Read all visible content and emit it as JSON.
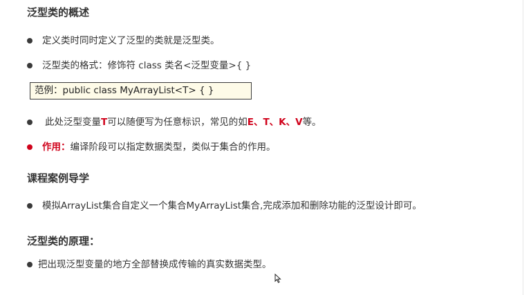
{
  "sections": {
    "overview": {
      "title": "泛型类的概述",
      "item1": "定义类时同时定义了泛型的类就是泛型类。",
      "item2": "泛型类的格式：修饰符 class 类名<泛型变量>{ }",
      "example": "范例：public class MyArrayList<T> { }",
      "item3": {
        "prefix": "此处泛型变量",
        "t": "T",
        "middle": "可以随便写为任意标识，常见的如",
        "letters": "E、T、K、V",
        "suffix": "等。"
      },
      "item4": {
        "label": "作用：",
        "text": "编译阶段可以指定数据类型，类似于集合的作用。"
      }
    },
    "case": {
      "title": "课程案例导学",
      "item1": "模拟ArrayList集合自定义一个集合MyArrayList集合,完成添加和删除功能的泛型设计即可。"
    },
    "principle": {
      "title": "泛型类的原理：",
      "item1": "把出现泛型变量的地方全部替换成传输的真实数据类型。"
    }
  },
  "colors": {
    "accent_red": "#d0021b",
    "example_bg": "#fefbe8",
    "text": "#333333"
  },
  "icons": {
    "cursor": "mouse-pointer-icon"
  }
}
